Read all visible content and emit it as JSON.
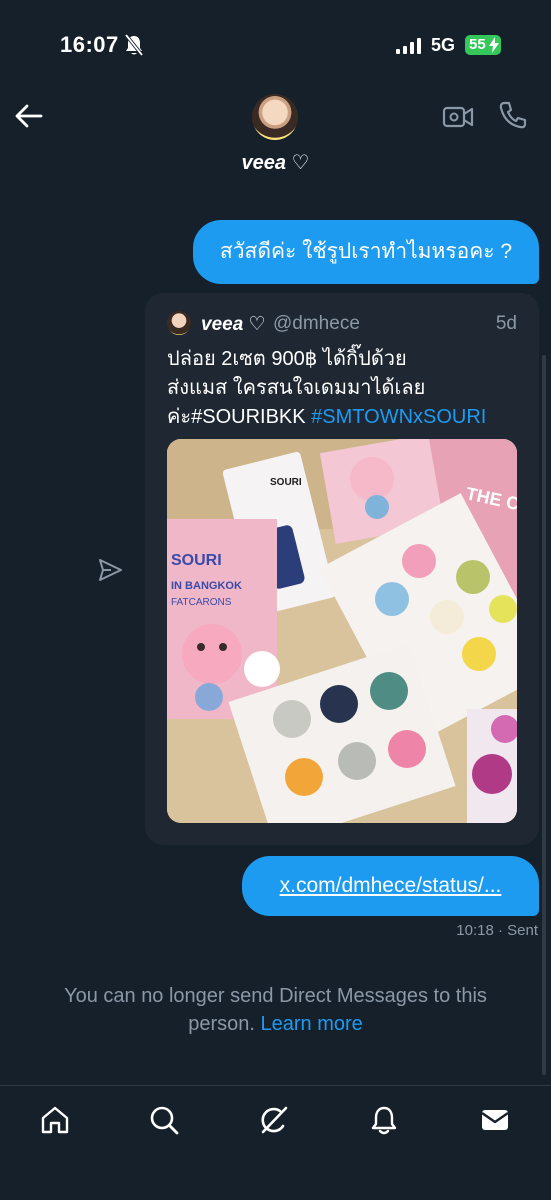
{
  "status_bar": {
    "time": "16:07",
    "network": "5G",
    "battery": "55"
  },
  "header": {
    "contact_name": "veea ♡"
  },
  "messages": {
    "greeting": "สวัสดีค่ะ ใช้รูปเราทำไมหรอคะ ?",
    "link": "x.com/dmhece/status/...",
    "meta": "10:18 · Sent"
  },
  "quoted_tweet": {
    "author": "veea ♡",
    "handle": "@dmhece",
    "time": "5d",
    "text_line_1": "ปล่อย 2เซต 900฿ ได้กิ๊ปด้วย",
    "text_line_2": "ส่งแมส ใครสนใจเดมมาได้เลย",
    "text_line_3_plain": "ค่ะ#SOURIBKK ",
    "text_line_3_link": "#SMTOWNxSOURI",
    "photo_labels": {
      "brand": "SOURI",
      "box_text": "IN BANGKOK",
      "box_subtext": "FATCARONS",
      "book_text": "THE C THE P"
    }
  },
  "notice": {
    "text": "You can no longer send Direct Messages to this person. ",
    "link": "Learn more"
  },
  "colors": {
    "background": "#15202b",
    "accent": "#1d9bf0",
    "card": "#1e2732",
    "muted": "#8b98a5"
  },
  "icons": {
    "back": "arrow-left-icon",
    "video": "video-camera-icon",
    "call": "phone-icon",
    "forward": "paper-plane-icon",
    "home": "home-icon",
    "search": "search-icon",
    "grok": "grok-icon",
    "notifications": "bell-icon",
    "messages": "envelope-icon"
  }
}
